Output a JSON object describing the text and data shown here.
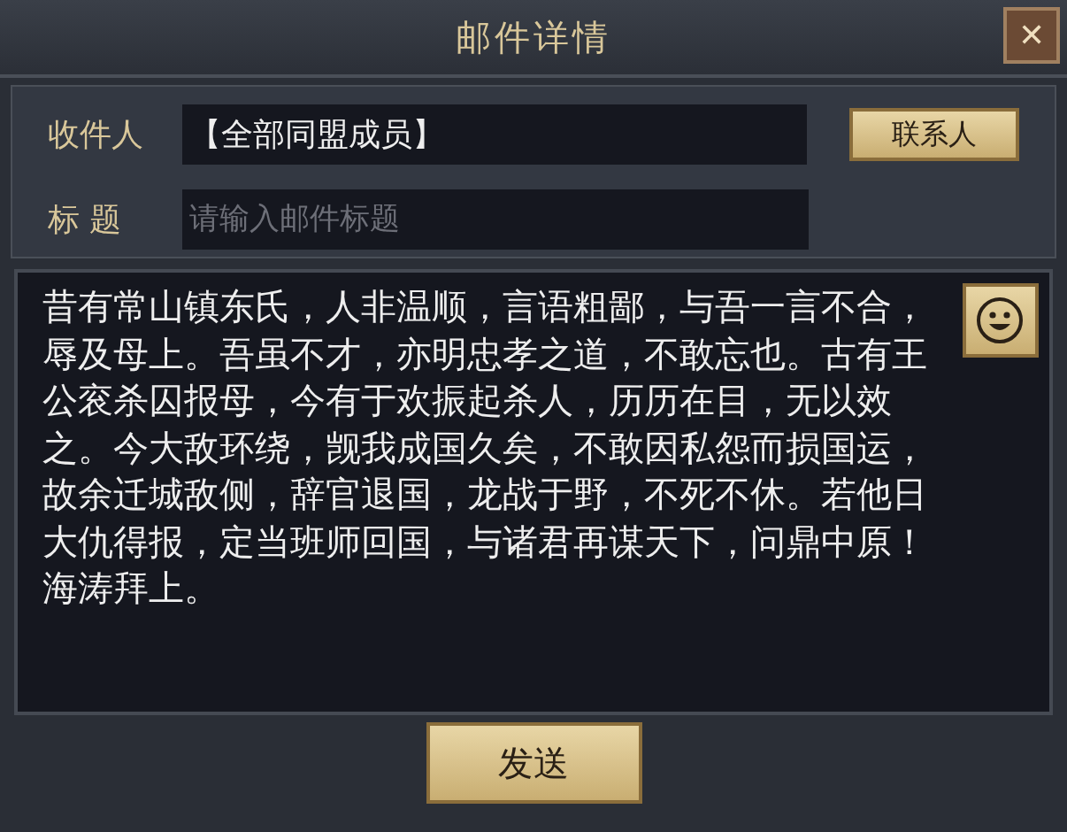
{
  "window": {
    "title": "邮件详情",
    "close": "✕"
  },
  "recipient": {
    "label": "收件人",
    "value": "【全部同盟成员】",
    "button": "联系人"
  },
  "subject": {
    "label": "标 题",
    "placeholder": "请输入邮件标题"
  },
  "body": {
    "value": "昔有常山镇东氏，人非温顺，言语粗鄙，与吾一言不合，辱及母上。吾虽不才，亦明忠孝之道，不敢忘也。古有王公衮杀囚报母，今有于欢振起杀人，历历在目，无以效之。今大敌环绕，觊我成国久矣，不敢因私怨而损国运，故余迁城敌侧，辞官退国，龙战于野，不死不休。若他日大仇得报，定当班师回国，与诸君再谋天下，问鼎中原！海涛拜上。"
  },
  "send_button": "发送"
}
